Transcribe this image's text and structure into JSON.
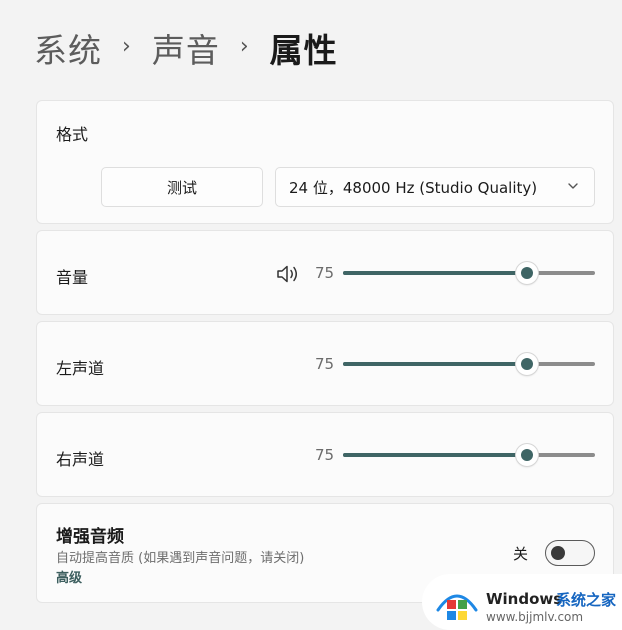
{
  "breadcrumb": {
    "items": [
      "系统",
      "声音",
      "属性"
    ],
    "separator": "›"
  },
  "format": {
    "label": "格式",
    "test_button": "测试",
    "select_value": "24 位，48000 Hz (Studio Quality)",
    "chevron_icon": "chevron-down-icon"
  },
  "volume": {
    "label": "音量",
    "icon": "speaker-icon",
    "value": "75",
    "fraction": 0.73
  },
  "left_channel": {
    "label": "左声道",
    "value": "75",
    "fraction": 0.73
  },
  "right_channel": {
    "label": "右声道",
    "value": "75",
    "fraction": 0.73
  },
  "enhance": {
    "title": "增强音频",
    "description": "自动提高音质 (如果遇到声音问题，请关闭)",
    "advanced_link": "高级",
    "toggle_label": "关",
    "toggle_on": false
  },
  "watermark": {
    "brand": "Windows",
    "site": "系统之家",
    "url": "www.bjjmlv.com"
  },
  "colors": {
    "accent": "#3f6565",
    "background": "#f3f3f3",
    "card": "#fbfbfb"
  }
}
